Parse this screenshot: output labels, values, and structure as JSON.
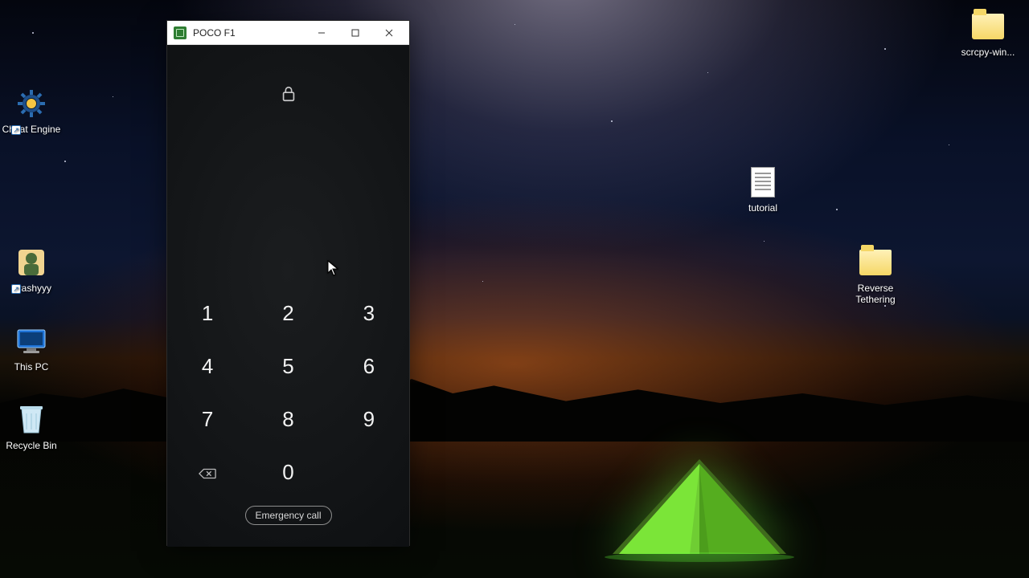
{
  "desktop_icons": {
    "left": [
      {
        "name": "cheat-engine",
        "label": "Cheat Engine",
        "kind": "gear",
        "shortcut": true
      },
      {
        "name": "crashyyy",
        "label": "Crashyyy",
        "kind": "avatar",
        "shortcut": true
      },
      {
        "name": "this-pc",
        "label": "This PC",
        "kind": "monitor",
        "shortcut": false
      },
      {
        "name": "recycle-bin",
        "label": "Recycle Bin",
        "kind": "recycle",
        "shortcut": false
      }
    ],
    "right": [
      {
        "name": "tutorial",
        "label": "tutorial",
        "kind": "textfile",
        "shortcut": false
      },
      {
        "name": "reverse-tethering",
        "label": "Reverse Tethering",
        "kind": "folder",
        "shortcut": false
      },
      {
        "name": "scrcpy-win",
        "label": "scrcpy-win...",
        "kind": "folder",
        "shortcut": false
      }
    ]
  },
  "window": {
    "title": "POCO F1"
  },
  "lockscreen": {
    "emergency_label": "Emergency call",
    "keys": [
      "1",
      "2",
      "3",
      "4",
      "5",
      "6",
      "7",
      "8",
      "9",
      "⌫",
      "0",
      ""
    ]
  }
}
